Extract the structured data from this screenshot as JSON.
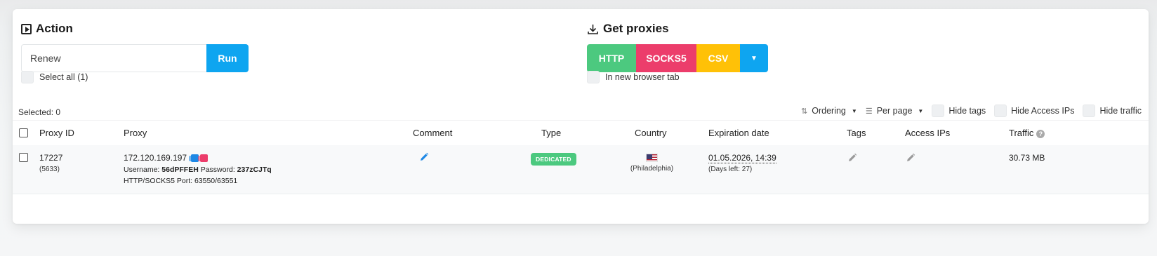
{
  "action": {
    "title": "Action",
    "input_value": "Renew",
    "run_label": "Run",
    "select_all_label": "Select all (1)"
  },
  "get_proxies": {
    "title": "Get proxies",
    "buttons": [
      {
        "label": "HTTP",
        "color": "#4cc97f"
      },
      {
        "label": "SOCKS5",
        "color": "#ec3d6b"
      },
      {
        "label": "CSV",
        "color": "#ffc107"
      },
      {
        "label": "",
        "color": "#0ea5f0"
      }
    ],
    "new_tab_label": "In new browser tab"
  },
  "selected_label": "Selected: 0",
  "toolbar": {
    "ordering_label": "Ordering",
    "per_page_label": "Per page",
    "hide_tags_label": "Hide tags",
    "hide_access_ips_label": "Hide Access IPs",
    "hide_traffic_label": "Hide traffic"
  },
  "table": {
    "headers": {
      "proxy_id": "Proxy ID",
      "proxy": "Proxy",
      "comment": "Comment",
      "type": "Type",
      "country": "Country",
      "expiration": "Expiration date",
      "tags": "Tags",
      "access_ips": "Access IPs",
      "traffic": "Traffic"
    },
    "rows": [
      {
        "id": "17227",
        "sub_id": "(5633)",
        "ip": "172.120.169.197",
        "username_label": "Username:",
        "username": "56dPFFEH",
        "password_label": "Password:",
        "password": "237zCJTq",
        "ports": "HTTP/SOCKS5 Port: 63550/63551",
        "type_badge": "DEDICATED",
        "type_color": "#4cc97f",
        "country_city": "(Philadelphia)",
        "expiration": "01.05.2026, 14:39",
        "days_left": "(Days left: 27)",
        "traffic": "30.73 MB"
      }
    ]
  },
  "colors": {
    "accent": "#0ea5f0",
    "copy_blue": "#1e88e5",
    "copy_pink": "#ec3d6b",
    "pencil_blue": "#1e88e5",
    "pencil_gray": "#9a9a9a"
  }
}
